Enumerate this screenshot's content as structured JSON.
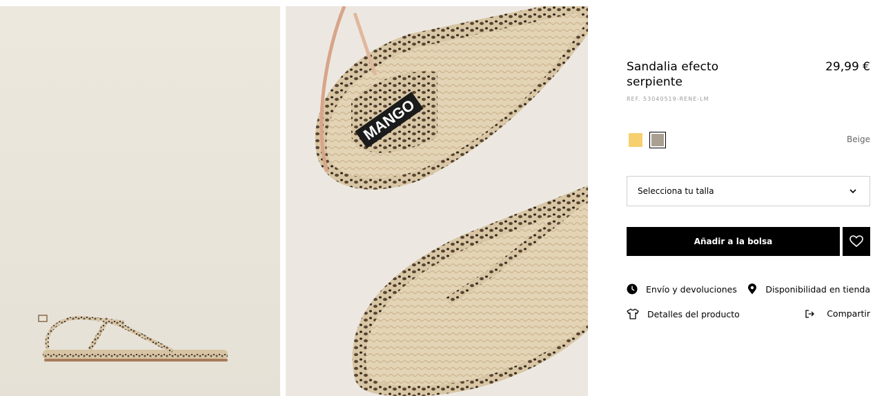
{
  "product": {
    "title": "Sandalia efecto serpiente",
    "price": "29,99 €",
    "ref": "REF. 53040519-RENE-LM",
    "brand_on_insole": "MANGO"
  },
  "colors": {
    "selected_name": "Beige",
    "options": [
      {
        "name": "yellow",
        "hex": "#f6cf6e"
      },
      {
        "name": "Beige",
        "hex": "#a9a092"
      }
    ]
  },
  "size_select": {
    "placeholder": "Selecciona tu talla"
  },
  "actions": {
    "add_to_bag": "Añadir a la bolsa",
    "wishlist_icon": "heart-icon"
  },
  "links": {
    "shipping": "Envío y devoluciones",
    "availability": "Disponibilidad en tienda",
    "details": "Detalles del producto",
    "share": "Compartir"
  }
}
